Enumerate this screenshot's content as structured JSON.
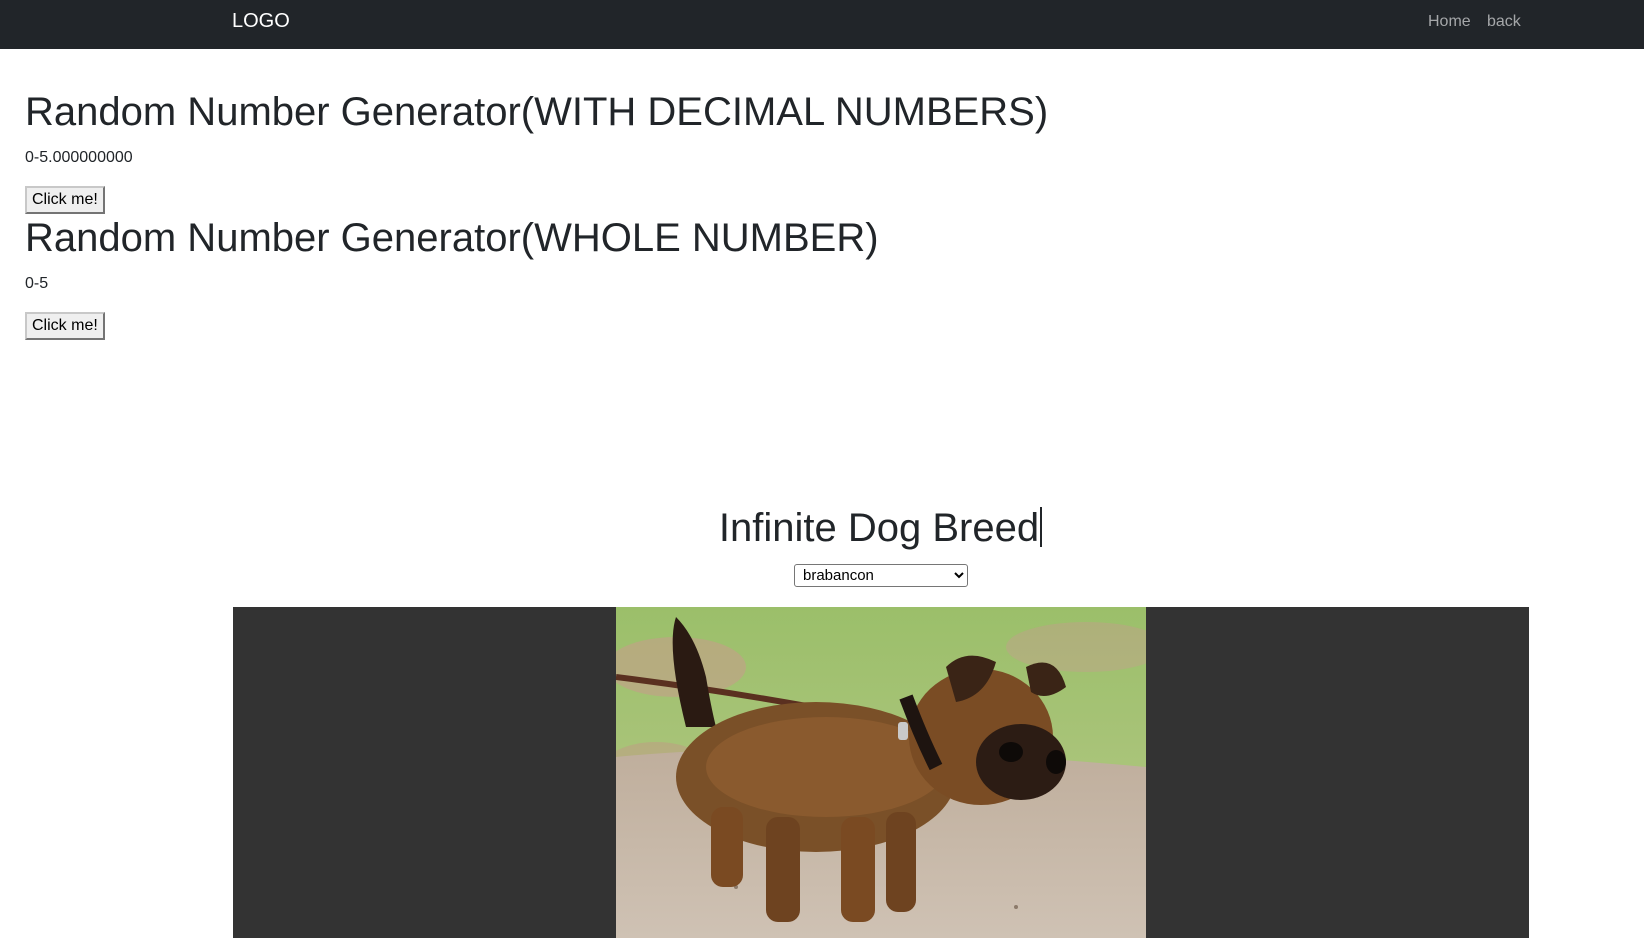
{
  "navbar": {
    "logo": "LOGO",
    "links": [
      "Home",
      "back"
    ]
  },
  "decimal_generator": {
    "title": "Random Number Generator(WITH DECIMAL NUMBERS)",
    "range": "0-5.000000000",
    "button_label": "Click me!"
  },
  "whole_generator": {
    "title": "Random Number Generator(WHOLE NUMBER)",
    "range": "0-5",
    "button_label": "Click me!"
  },
  "dog_breed": {
    "title": "Infinite Dog Breed",
    "selected_breed": "brabancon",
    "image_subject": "brabancon puppy on leash"
  },
  "colors": {
    "navbar_bg": "#212529",
    "viewer_bg": "#333333"
  }
}
